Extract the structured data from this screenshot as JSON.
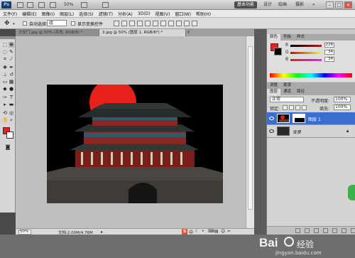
{
  "app": {
    "logo_text": "Ps",
    "zoom_display": "50%",
    "workspace_buttons": [
      "基本功能",
      "设计",
      "绘画",
      "摄影"
    ],
    "more_symbol": "»",
    "window_controls": [
      "–",
      "□",
      "×"
    ]
  },
  "menu": [
    "文件(F)",
    "编辑(E)",
    "图像(I)",
    "图层(L)",
    "选择(S)",
    "滤镜(T)",
    "分析(A)",
    "3D(D)",
    "视图(V)",
    "窗口(W)",
    "帮助(H)"
  ],
  "options_bar": {
    "auto_select_label": "自动选择:",
    "auto_select_value": "组",
    "show_transform_label": "显示变换控件"
  },
  "tabs": [
    {
      "label": "天安门.jpg @ 50% (灰色, RGB/8) *",
      "active": false
    },
    {
      "label": "3.jpg @ 50% (图层 1, RGB/8*) *",
      "active": true
    }
  ],
  "status": {
    "zoom": "50%",
    "doc_info": "文档:2.00M/4.76M"
  },
  "color_panel": {
    "tabs": [
      "颜色",
      "色板",
      "样式"
    ],
    "channels": [
      {
        "label": "R",
        "value": "228"
      },
      {
        "label": "G",
        "value": "34"
      },
      {
        "label": "B",
        "value": "34"
      }
    ],
    "foreground": "#e42222"
  },
  "adjust_tabs": [
    "调整",
    "蒙版"
  ],
  "layers_panel": {
    "tabs": [
      "图层",
      "通道",
      "路径"
    ],
    "blend_mode": "正常",
    "opacity_label": "不透明度:",
    "opacity_value": "100%",
    "lock_label": "锁定:",
    "fill_label": "填充:",
    "fill_value": "100%",
    "layers": [
      {
        "name": "图层 1",
        "selected": true
      },
      {
        "name": "背景",
        "selected": false
      }
    ]
  },
  "watermark": {
    "brand": "Bai",
    "brand2": "经验",
    "url": "jingyan.baidu.com"
  },
  "colors": {
    "accent": "#3a6fd1",
    "sun": "#e8201c"
  }
}
